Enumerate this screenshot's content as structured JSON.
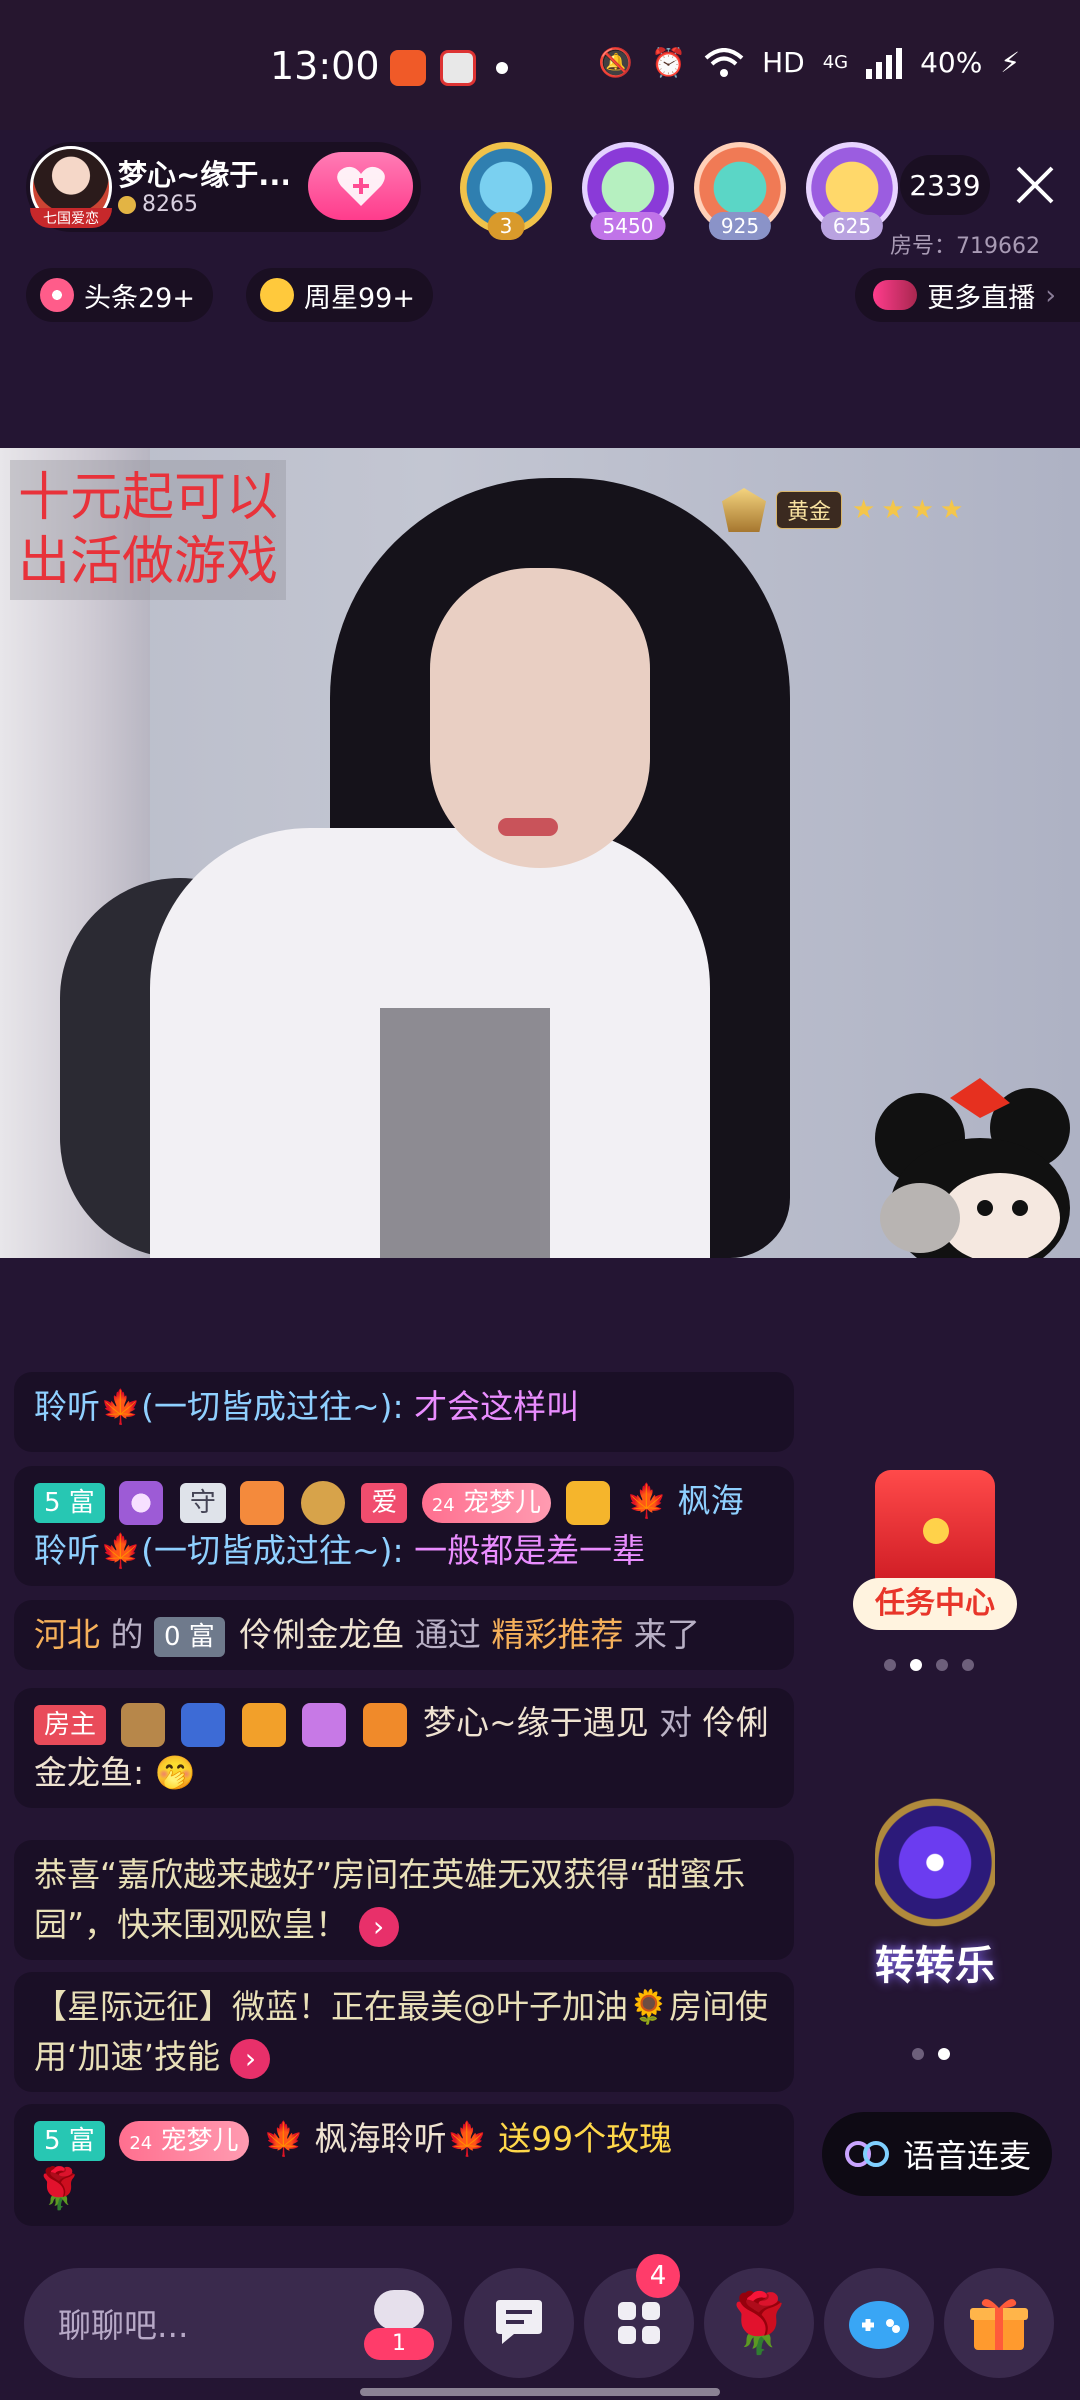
{
  "status_bar": {
    "time": "13:00",
    "network": "HD",
    "network_type": "4G",
    "battery": "40%"
  },
  "room": {
    "host_name": "梦心~缘于...",
    "host_coins": "8265",
    "avatar_caption": "七国爱恋",
    "fan_scores": [
      "3",
      "5450",
      "925",
      "625"
    ],
    "viewers": "2339",
    "room_number": "房号：719662",
    "chips": {
      "headline": "头条29+",
      "weekly_star": "周星99+"
    },
    "more_live": "更多直播"
  },
  "video": {
    "overlay_line1": "十元起可以",
    "overlay_line2": "出活做游戏",
    "rank_label": "黄金",
    "rank_stars": 4
  },
  "chat": {
    "msg1": {
      "text": "聆听🍁(一切皆成过往~): ",
      "said": "才会这样叫"
    },
    "msg2": {
      "rich": "5 富",
      "guard": "守",
      "heart_text": "爱",
      "pet_level": "24",
      "pet_label": "宠梦儿",
      "user": "🍁 枫海聆听🍁(一切皆成过往~): ",
      "said": "一般都是差一辈"
    },
    "msg3": {
      "region": "河北",
      "of": "的",
      "rich": "0 富",
      "user": "伶俐金龙鱼",
      "via": "通过",
      "source": "精彩推荐",
      "came": "来了"
    },
    "msg4": {
      "host_badge": "房主",
      "user": "梦心~缘于遇见",
      "to": "对",
      "target": "伶俐金龙鱼:",
      "emoji": "🤭"
    },
    "msg5": {
      "text": "恭喜“嘉欣越来越好”房间在英雄无双获得“甜蜜乐园”，快来围观欧皇！",
      "arrow": "›"
    },
    "msg6": {
      "text": "【星际远征】微蓝！正在最美@叶子加油🌻房间使用‘加速’技能",
      "arrow": "›"
    },
    "msg7": {
      "rich": "5 富",
      "pet_level": "24",
      "pet_label": "宠梦儿",
      "user": "🍁 枫海聆听🍁",
      "gift": "送99个玫瑰",
      "gift_emoji": "🌹"
    }
  },
  "widgets": {
    "task_center": "任务中心",
    "spin": "转转乐",
    "voice_link": "语音连麦"
  },
  "bottom": {
    "input_placeholder": "聊聊吧...",
    "input_badge": "1",
    "apps_notif": "4"
  }
}
